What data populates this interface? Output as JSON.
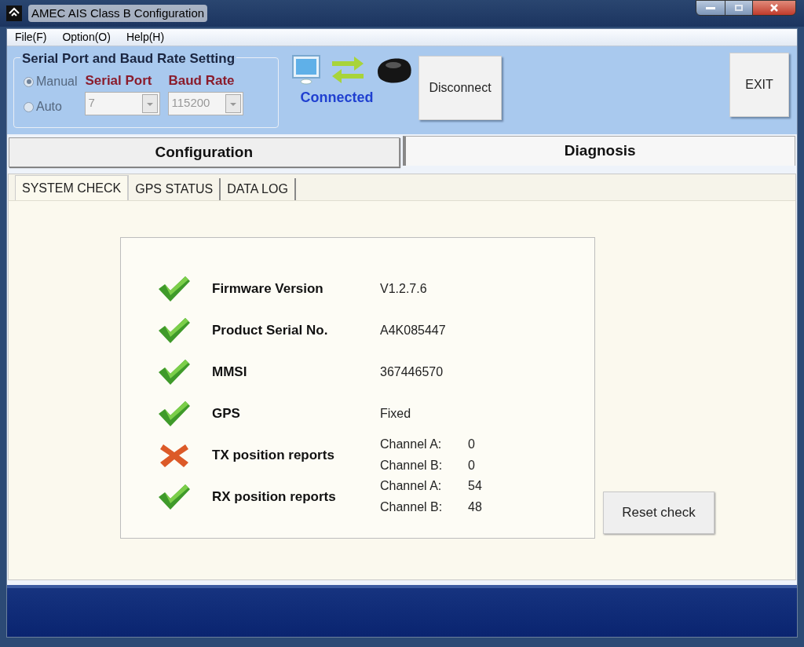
{
  "window": {
    "title": "AMEC AIS Class B Configuration"
  },
  "menu": [
    "File(F)",
    "Option(O)",
    "Help(H)"
  ],
  "serial_settings": {
    "title": "Serial Port and Baud Rate Setting",
    "disabled": true,
    "modes": [
      {
        "label": "Manual",
        "selected": true
      },
      {
        "label": "Auto",
        "selected": false
      }
    ],
    "serial_port": {
      "label": "Serial Port",
      "value": "7"
    },
    "baud_rate": {
      "label": "Baud Rate",
      "value": "115200"
    }
  },
  "connection": {
    "status": "Connected"
  },
  "disconnect_button": "Disconnect",
  "exit_button": "EXIT",
  "main_tabs": [
    {
      "label": "Configuration",
      "selected": false
    },
    {
      "label": "Diagnosis",
      "selected": true
    }
  ],
  "sub_tabs": [
    {
      "label": "SYSTEM CHECK",
      "selected": true
    },
    {
      "label": "GPS STATUS",
      "selected": false
    },
    {
      "label": "DATA LOG",
      "selected": false
    }
  ],
  "checks": [
    {
      "label": "Firmware Version",
      "passed": true,
      "kind": "single",
      "value": "V1.2.7.6"
    },
    {
      "label": "Product Serial No.",
      "passed": true,
      "kind": "single",
      "value": "A4K085447"
    },
    {
      "label": "MMSI",
      "passed": true,
      "kind": "single",
      "value": "367446570"
    },
    {
      "label": "GPS",
      "passed": true,
      "kind": "single",
      "value": "Fixed"
    },
    {
      "label": "TX position reports",
      "passed": false,
      "kind": "channels",
      "channels": [
        {
          "label": "Channel A:",
          "value": "0"
        },
        {
          "label": "Channel B:",
          "value": "0"
        }
      ]
    },
    {
      "label": "RX position reports",
      "passed": true,
      "kind": "channels",
      "channels": [
        {
          "label": "Channel A:",
          "value": "54"
        },
        {
          "label": "Channel B:",
          "value": "48"
        }
      ]
    }
  ],
  "reset_button": "Reset check"
}
